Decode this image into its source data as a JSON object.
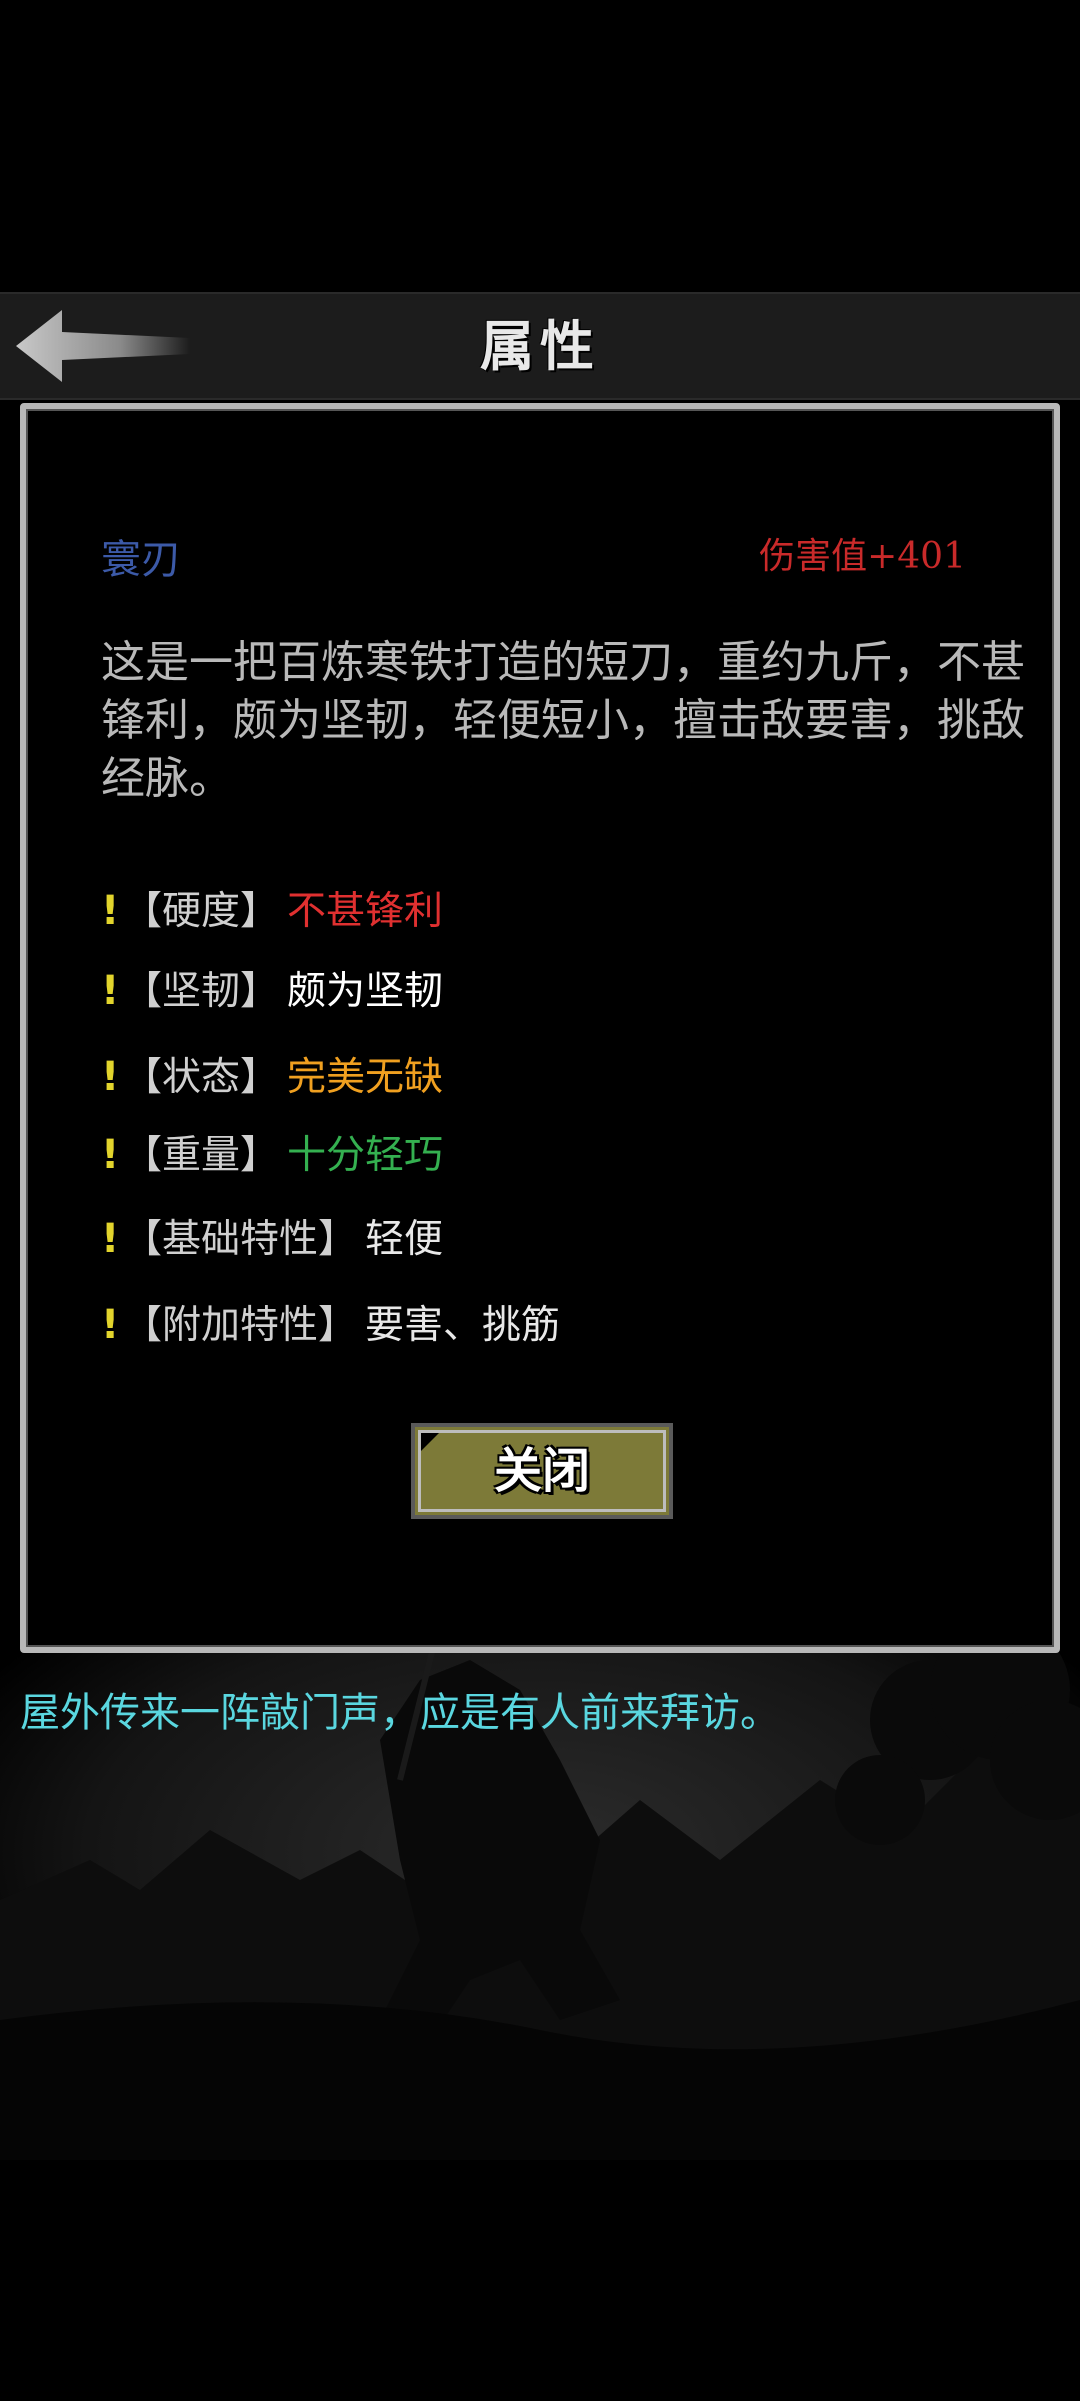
{
  "header": {
    "title": "属性"
  },
  "item": {
    "name": "寰刃",
    "damage": "伤害值+401",
    "description": "这是一把百炼寒铁打造的短刀，重约九斤，不甚锋利，颇为坚韧，轻便短小，擅击敌要害，挑敌经脉。"
  },
  "attributes": [
    {
      "mark": "!",
      "label": "【硬度】",
      "value": "不甚锋利",
      "color": "#e03030"
    },
    {
      "mark": "!",
      "label": "【坚韧】",
      "value": "颇为坚韧",
      "color": "#ffffff"
    },
    {
      "mark": "!",
      "label": "【状态】",
      "value": "完美无缺",
      "color": "#f0a020"
    },
    {
      "mark": "!",
      "label": "【重量】",
      "value": "十分轻巧",
      "color": "#34b050"
    },
    {
      "mark": "!",
      "label": "【基础特性】",
      "value": "轻便",
      "color": "#e8e8e8"
    },
    {
      "mark": "!",
      "label": "【附加特性】",
      "value": "要害、挑筋",
      "color": "#e8e8e8"
    }
  ],
  "buttons": {
    "close_label": "关闭"
  },
  "event_log": {
    "message": "屋外传来一阵敲门声，应是有人前来拜访。"
  },
  "colors": {
    "item_name": "#3c5aa8",
    "damage": "#c92a2a",
    "event_text": "#5ad7e0",
    "close_button_bg": "#7d7a38"
  },
  "icons": {
    "back": "back-arrow-icon"
  }
}
